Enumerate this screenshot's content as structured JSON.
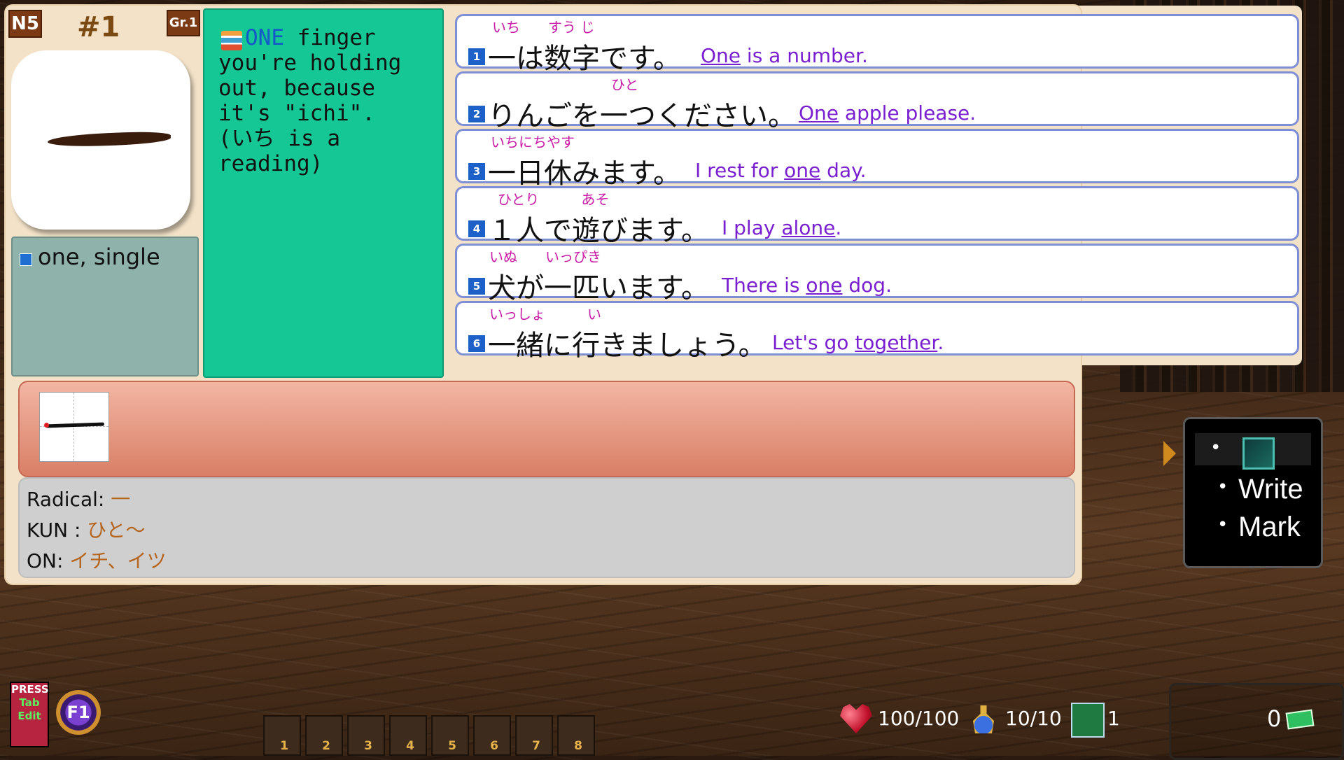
{
  "card": {
    "level": "N5",
    "number": "#1",
    "grade": "Gr.1",
    "meaning": "one, single",
    "mnemonic_keyword": "ONE",
    "mnemonic_rest": " finger you're holding out, because it's \"ichi\".",
    "mnemonic_note": "(いち is a reading)"
  },
  "sentences": [
    {
      "num": "1",
      "ruby": "いち　　すう じ",
      "jp": "一は数字です。",
      "en_pre": "",
      "en_key": "One",
      "en_post": " is a number."
    },
    {
      "num": "2",
      "ruby": "ひと",
      "jp": "りんごを一つください。",
      "en_pre": "",
      "en_key": "One",
      "en_post": " apple please."
    },
    {
      "num": "3",
      "ruby": "いちにちやす",
      "jp": "一日休みます。",
      "en_pre": "I rest for ",
      "en_key": "one",
      "en_post": " day."
    },
    {
      "num": "4",
      "ruby": "ひとり　　　あそ",
      "jp": "１人で遊びます。",
      "en_pre": "I play ",
      "en_key": "alone",
      "en_post": "."
    },
    {
      "num": "5",
      "ruby": "いぬ　　いっぴき",
      "jp": "犬が一匹います。",
      "en_pre": "There is ",
      "en_key": "one",
      "en_post": " dog."
    },
    {
      "num": "6",
      "ruby": "いっしょ　　　い",
      "jp": "一緒に行きましょう。",
      "en_pre": "Let's go ",
      "en_key": "together",
      "en_post": "."
    }
  ],
  "readings": {
    "radical_label": "Radical:",
    "radical_value": "一",
    "kun_label": "KUN :",
    "kun_value": "ひと〜",
    "on_label": "ON:",
    "on_value": "イチ、イツ"
  },
  "menu": {
    "bullet": "•",
    "items": [
      "Write",
      "Mark"
    ]
  },
  "hud": {
    "press": "PRESS",
    "tab": "Tab",
    "edit": "Edit",
    "f1": "F1",
    "hotbar": [
      "1",
      "2",
      "3",
      "4",
      "5",
      "6",
      "7",
      "8"
    ],
    "health": "100/100",
    "mana": "10/10",
    "cards": "1",
    "money": "0"
  },
  "colors": {
    "mnemonic_bg": "#15c794",
    "keyword": "#1559c8",
    "ruby": "#c71aa6",
    "english": "#7a1fd0",
    "reading_value": "#b5651d"
  },
  "icons": [
    "heart-icon",
    "potion-icon",
    "kanji-card-icon",
    "money-icon",
    "books-icon",
    "edit-icon"
  ]
}
